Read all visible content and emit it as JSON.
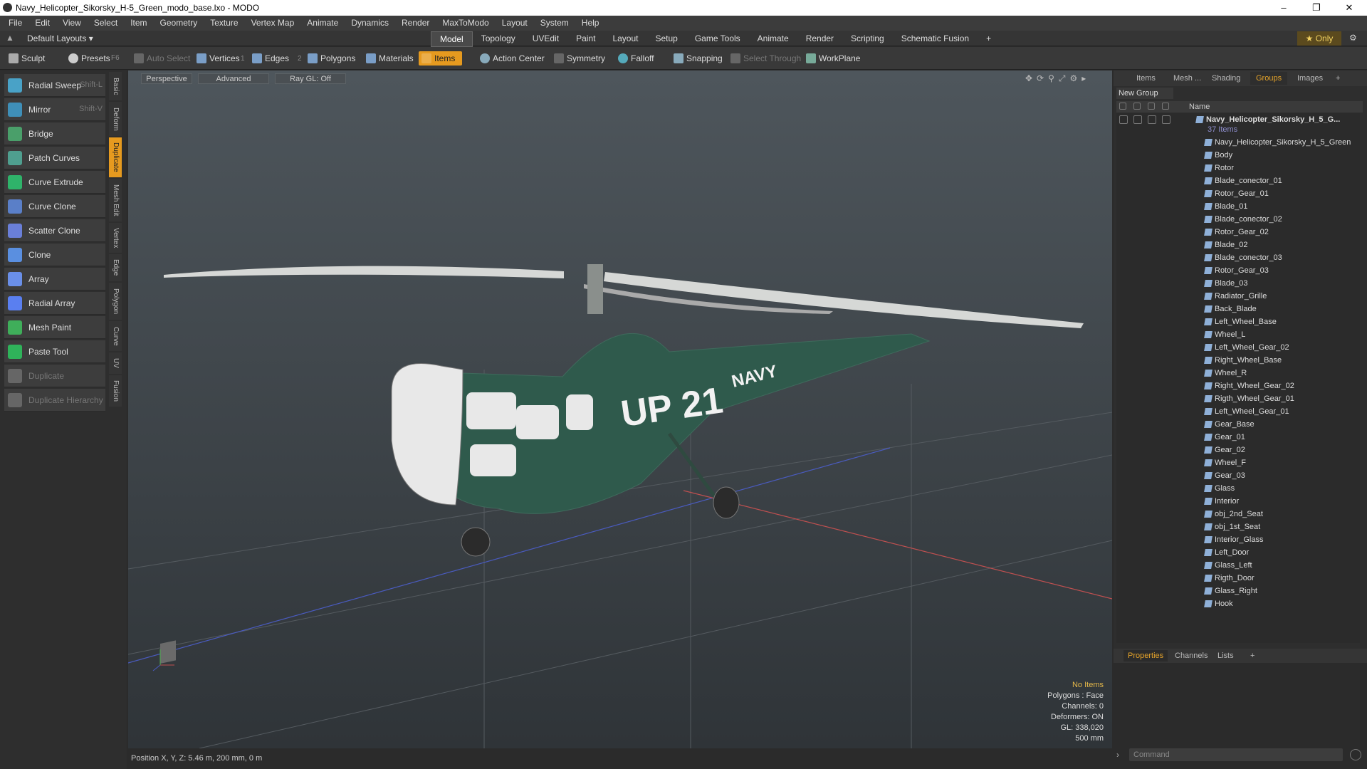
{
  "window": {
    "title": "Navy_Helicopter_Sikorsky_H-5_Green_modo_base.lxo - MODO"
  },
  "menu": [
    "File",
    "Edit",
    "View",
    "Select",
    "Item",
    "Geometry",
    "Texture",
    "Vertex Map",
    "Animate",
    "Dynamics",
    "Render",
    "MaxToModo",
    "Layout",
    "System",
    "Help"
  ],
  "layout": {
    "label": "Default Layouts ▾",
    "only": "★ Only"
  },
  "tabs": [
    "Model",
    "Topology",
    "UVEdit",
    "Paint",
    "Layout",
    "Setup",
    "Game Tools",
    "Animate",
    "Render",
    "Scripting",
    "Schematic Fusion",
    "+"
  ],
  "toolbar": {
    "sculpt": "Sculpt",
    "presets": "Presets",
    "presets_sc": "F6",
    "auto_select": "Auto Select",
    "vertices": "Vertices",
    "vertices_n": "1",
    "edges": "Edges",
    "edges_n": "2",
    "polygons": "Polygons",
    "materials": "Materials",
    "items": "Items",
    "action_center": "Action Center",
    "symmetry": "Symmetry",
    "falloff": "Falloff",
    "snapping": "Snapping",
    "select_through": "Select Through",
    "workplane": "WorkPlane"
  },
  "tools": [
    {
      "label": "Radial Sweep",
      "sc": "Shift-L"
    },
    {
      "label": "Mirror",
      "sc": "Shift-V"
    },
    {
      "label": "Bridge",
      "sc": ""
    },
    {
      "label": "Patch Curves",
      "sc": ""
    },
    {
      "label": "Curve Extrude",
      "sc": ""
    },
    {
      "label": "Curve Clone",
      "sc": ""
    },
    {
      "label": "Scatter Clone",
      "sc": ""
    },
    {
      "label": "Clone",
      "sc": ""
    },
    {
      "label": "Array",
      "sc": ""
    },
    {
      "label": "Radial Array",
      "sc": ""
    },
    {
      "label": "Mesh Paint",
      "sc": ""
    },
    {
      "label": "Paste Tool",
      "sc": ""
    },
    {
      "label": "Duplicate",
      "sc": ""
    },
    {
      "label": "Duplicate Hierarchy",
      "sc": ""
    }
  ],
  "vtabs": [
    "Basic",
    "Deform",
    "Duplicate",
    "Mesh Edit",
    "Vertex",
    "Edge",
    "Polygon",
    "Curve",
    "UV",
    "Fusion"
  ],
  "viewport": {
    "perspective": "Perspective",
    "advanced": "Advanced",
    "raygl": "Ray GL: Off",
    "hud": {
      "no_items": "No Items",
      "polygons": "Polygons : Face",
      "channels": "Channels: 0",
      "deformers": "Deformers: ON",
      "gl": "GL: 338,020",
      "scale": "500 mm"
    },
    "fuselage": {
      "code": "UP 21",
      "navy": "NAVY"
    }
  },
  "status": {
    "position": "Position X, Y, Z:  5.46 m, 200 mm, 0 m"
  },
  "right": {
    "tabs": [
      "Items",
      "Mesh ...",
      "Shading",
      "Groups",
      "Images",
      "+"
    ],
    "new_group": "New Group",
    "name_col": "Name",
    "group_name": "Navy_Helicopter_Sikorsky_H_5_G...",
    "group_count": "37 Items",
    "items": [
      "Navy_Helicopter_Sikorsky_H_5_Green",
      "Body",
      "Rotor",
      "Blade_conector_01",
      "Rotor_Gear_01",
      "Blade_01",
      "Blade_conector_02",
      "Rotor_Gear_02",
      "Blade_02",
      "Blade_conector_03",
      "Rotor_Gear_03",
      "Blade_03",
      "Radiator_Grille",
      "Back_Blade",
      "Left_Wheel_Base",
      "Wheel_L",
      "Left_Wheel_Gear_02",
      "Right_Wheel_Base",
      "Wheel_R",
      "Right_Wheel_Gear_02",
      "Rigth_Wheel_Gear_01",
      "Left_Wheel_Gear_01",
      "Gear_Base",
      "Gear_01",
      "Gear_02",
      "Wheel_F",
      "Gear_03",
      "Glass",
      "Interior",
      "obj_2nd_Seat",
      "obj_1st_Seat",
      "Interior_Glass",
      "Left_Door",
      "Glass_Left",
      "Rigth_Door",
      "Glass_Right",
      "Hook"
    ],
    "bottom_tabs": [
      "Properties",
      "Channels",
      "Lists",
      "+"
    ],
    "command": "Command"
  },
  "colors": {
    "accent": "#e69a1f",
    "hull": "#2f5a4c"
  }
}
